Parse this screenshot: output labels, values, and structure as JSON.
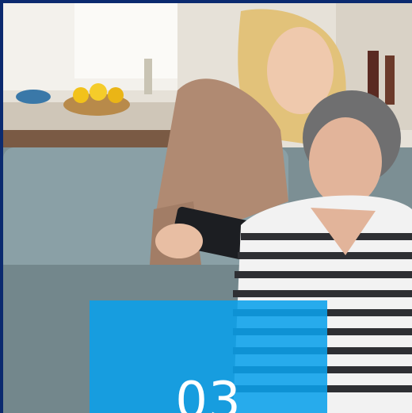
{
  "photo": {
    "subject": "young-woman-and-elderly-woman-looking-at-phone-on-sofa"
  },
  "tile": {
    "number": "03",
    "color": "#0aa0eb"
  },
  "colors": {
    "frame": "#0b2a6f"
  }
}
